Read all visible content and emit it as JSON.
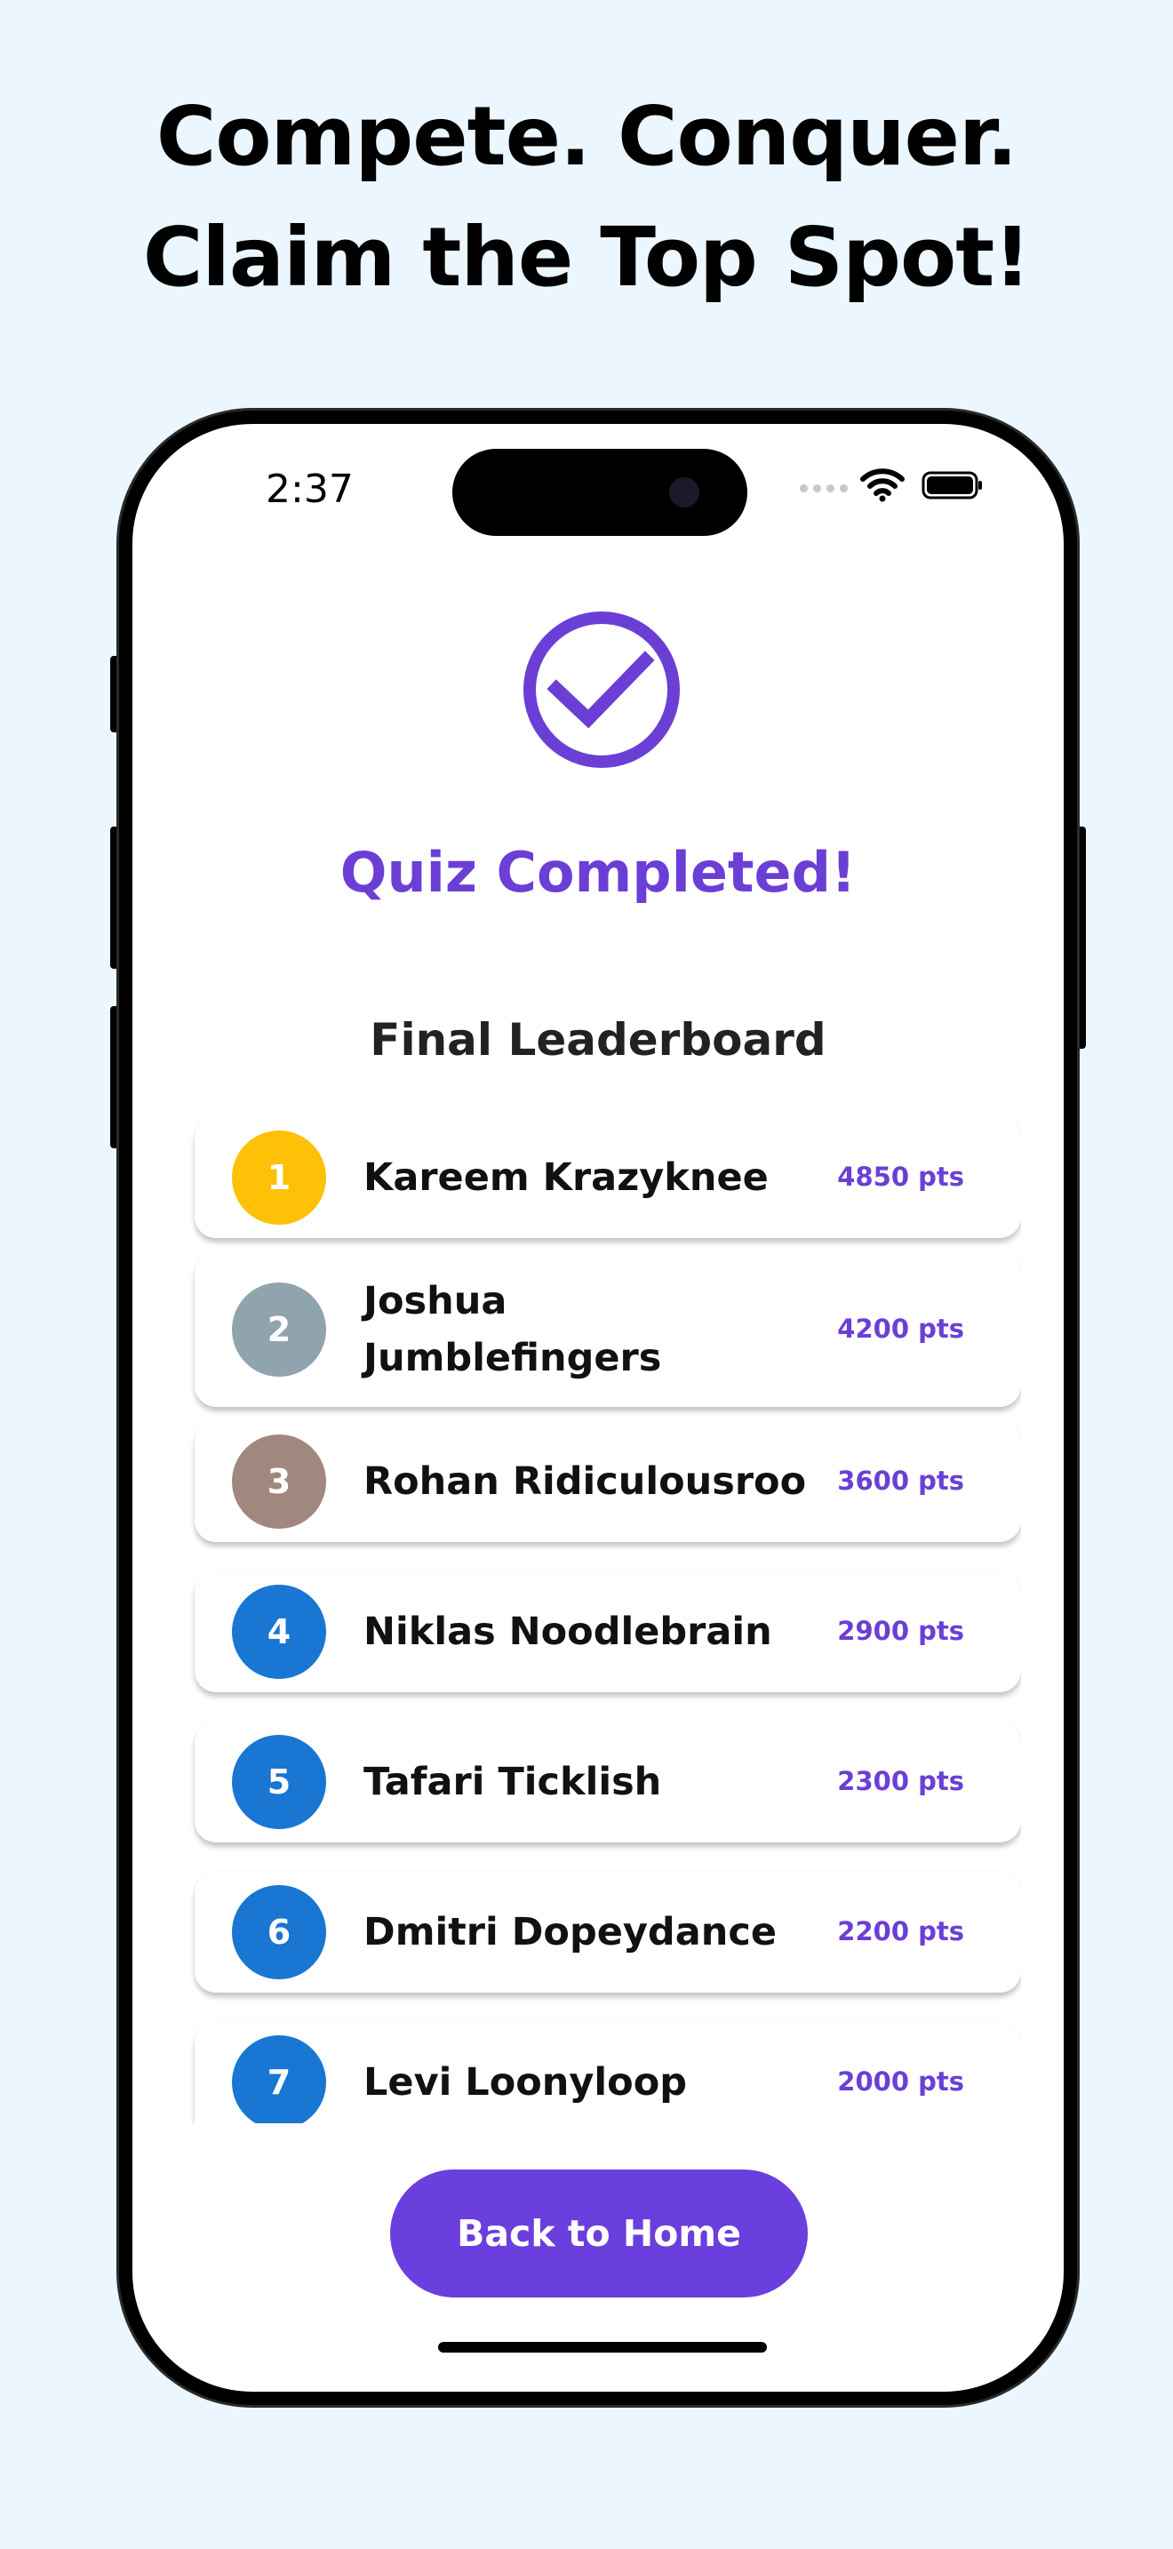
{
  "headline": {
    "line1": "Compete. Conquer.",
    "line2": "Claim the Top Spot!"
  },
  "status_bar": {
    "time": "2:37"
  },
  "result": {
    "title": "Quiz Completed!",
    "leaderboard_title": "Final Leaderboard"
  },
  "leaderboard": [
    {
      "rank": "1",
      "name": "Kareem Krazyknee",
      "score": "4850 pts",
      "color": "#FFC107"
    },
    {
      "rank": "2",
      "name": "Joshua Jumblefingers",
      "score": "4200 pts",
      "color": "#90A4AE"
    },
    {
      "rank": "3",
      "name": "Rohan Ridiculousroo",
      "score": "3600 pts",
      "color": "#A1887F"
    },
    {
      "rank": "4",
      "name": "Niklas Noodlebrain",
      "score": "2900 pts",
      "color": "#1976D2"
    },
    {
      "rank": "5",
      "name": "Tafari Ticklish",
      "score": "2300 pts",
      "color": "#1976D2"
    },
    {
      "rank": "6",
      "name": "Dmitri Dopeydance",
      "score": "2200 pts",
      "color": "#1976D2"
    },
    {
      "rank": "7",
      "name": "Levi Loonyloop",
      "score": "2000 pts",
      "color": "#1976D2"
    }
  ],
  "actions": {
    "back_home_label": "Back to Home"
  },
  "colors": {
    "accent": "#6B3FD6",
    "background": "#EBF6FE"
  }
}
